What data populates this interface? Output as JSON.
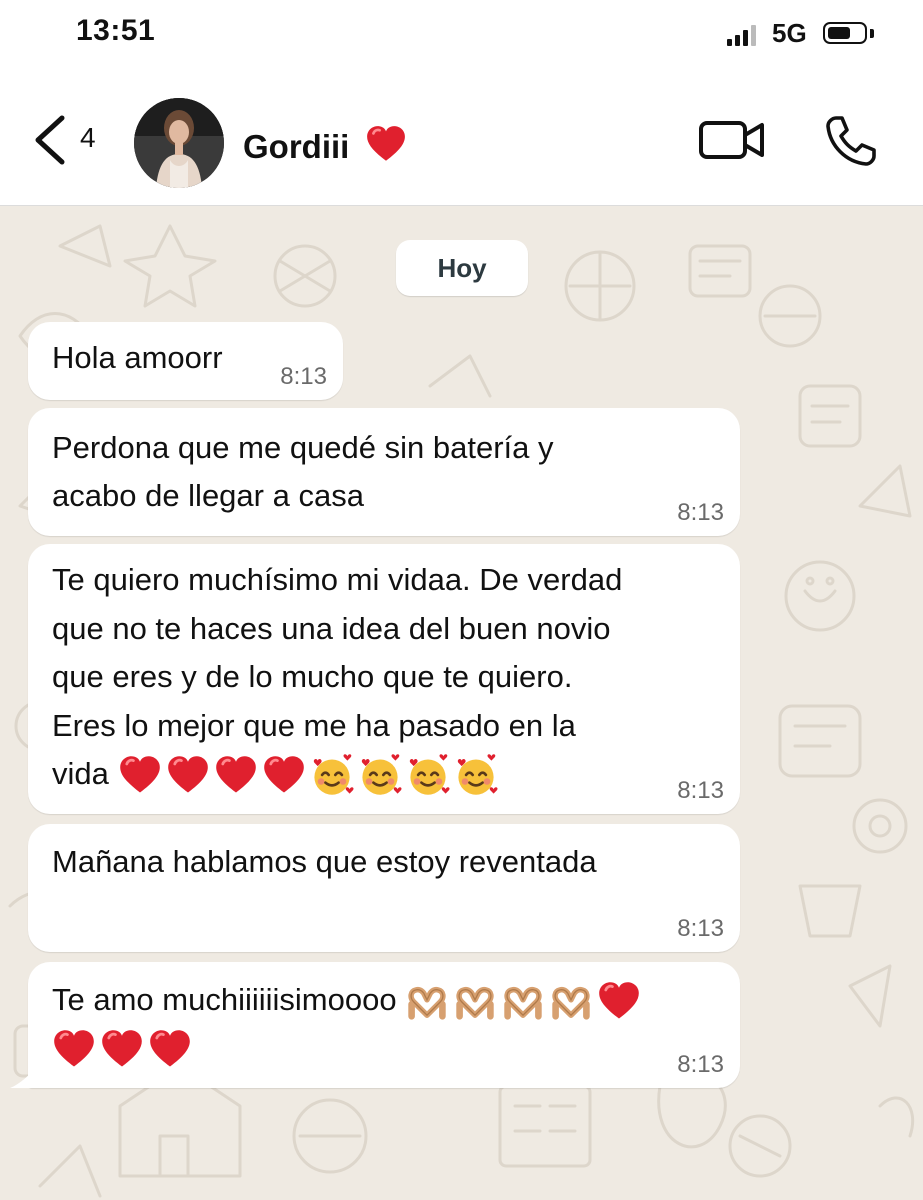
{
  "status": {
    "time": "13:51",
    "network": "5G"
  },
  "header": {
    "back_count": "4",
    "contact_name": "Gordiii",
    "name_emoji": "red-heart"
  },
  "chat": {
    "date_label": "Hoy",
    "messages": [
      {
        "lines": [
          "Hola amoorr"
        ],
        "time": "8:13"
      },
      {
        "lines": [
          "Perdona que me quedé sin batería y",
          "acabo de llegar a casa"
        ],
        "time": "8:13"
      },
      {
        "lines": [
          "Te quiero muchísimo mi vidaa. De verdad",
          "que no te haces una idea del buen novio",
          "que eres y de lo mucho que te quiero.",
          "Eres lo mejor que me ha pasado en la",
          "vida"
        ],
        "emojis": [
          "red-heart",
          "red-heart",
          "red-heart",
          "red-heart",
          "smiling-face-with-hearts",
          "smiling-face-with-hearts",
          "smiling-face-with-hearts",
          "smiling-face-with-hearts"
        ],
        "time": "8:13"
      },
      {
        "lines": [
          "Mañana hablamos que estoy reventada"
        ],
        "time": "8:13"
      },
      {
        "lines": [
          "Te amo muchiiiiiisimoooo"
        ],
        "emojis": [
          "heart-hands",
          "heart-hands",
          "heart-hands",
          "heart-hands",
          "red-heart",
          "red-heart",
          "red-heart",
          "red-heart"
        ],
        "time": "8:13"
      }
    ]
  },
  "colors": {
    "chat_background": "#efeae2",
    "bubble": "#ffffff",
    "heart": "#e0202e",
    "timestamp": "#6a6a6a"
  }
}
